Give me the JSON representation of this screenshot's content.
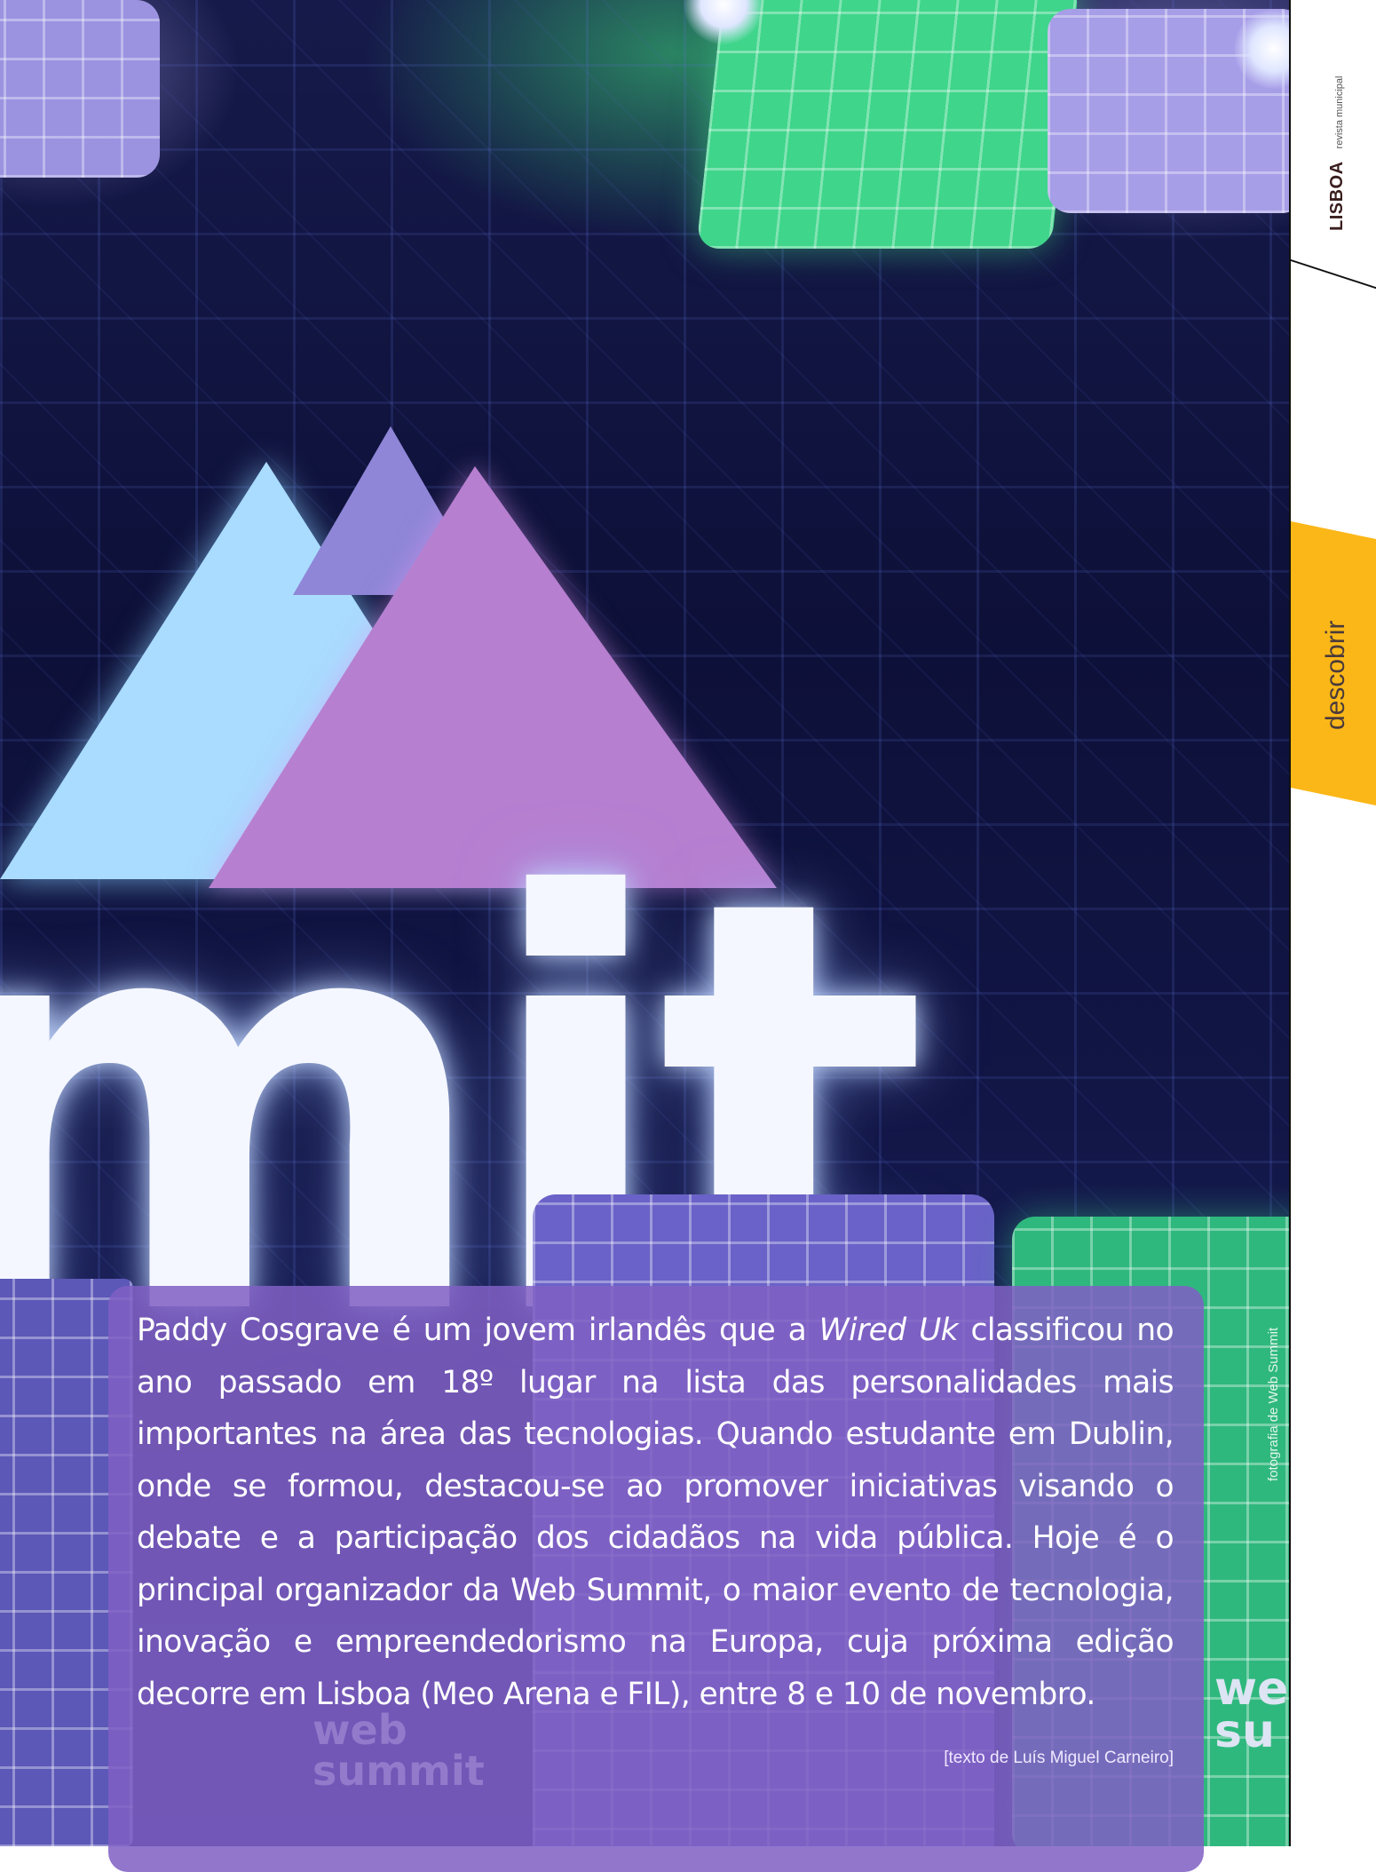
{
  "sidebar": {
    "magazine_name": "LISBOA",
    "magazine_subtitle": "revista municipal",
    "section_label": "descobrir",
    "section_color": "#fbb718"
  },
  "article": {
    "text_before_italic": "Paddy Cosgrave é um jovem irlandês que a ",
    "italic_publication": "Wired Uk",
    "text_after_italic": " classificou no ano passado em 18º lugar na lista das personalidades mais importantes na área das tecnologias. Quando estudante em Dublin, onde se formou, destacou-se ao promover iniciativas visando o debate e a participação dos cidadãos na vida pública. Hoje é o principal organizador da Web Summit, o maior evento de tecnologia, inovação e empreendedorismo na Europa, cuja próxima edição decorre em Lisboa (Meo Arena e FIL), entre 8 e 10 de novembro.",
    "byline": "[texto de Luís Miguel Carneiro]",
    "panel_color": "#8060c4"
  },
  "photo": {
    "credit": "fotografia de Web Summit",
    "sign_letters": "mit",
    "ghost_logo_line1": "web",
    "ghost_logo_line2": "summit",
    "corner_logo_line1": "we",
    "corner_logo_line2": "su"
  }
}
